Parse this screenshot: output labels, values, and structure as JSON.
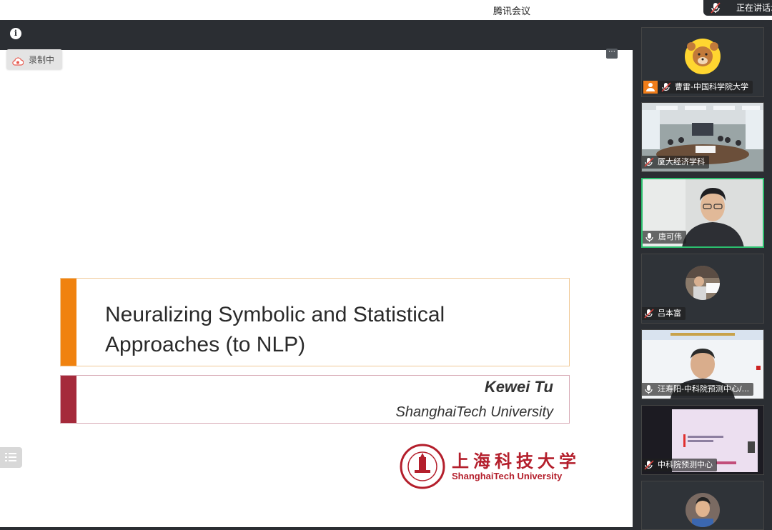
{
  "window": {
    "title": "腾讯会议"
  },
  "speaking_indicator": {
    "label": "正在讲话:"
  },
  "recording": {
    "label": "录制中"
  },
  "slide": {
    "title_line1": "Neuralizing Symbolic and Statistical",
    "title_line2": "Approaches (to NLP)",
    "author": "Kewei Tu",
    "affiliation": "ShanghaiTech University",
    "logo_cn": "上海科技大学",
    "logo_en": "ShanghaiTech University",
    "accent_orange": "#f0820f",
    "accent_red": "#a52a3b"
  },
  "participants": [
    {
      "name": "曹雷-中国科学院大学",
      "mic": "muted",
      "avatar": "bear-avatar",
      "host_badge": true
    },
    {
      "name": "厦大经济学科",
      "mic": "muted",
      "avatar": "video-conference-room"
    },
    {
      "name": "唐可伟",
      "mic": "on",
      "avatar": "video-man-glasses",
      "active": true
    },
    {
      "name": "吕本富",
      "mic": "muted",
      "avatar": "person-at-desk"
    },
    {
      "name": "汪寿阳-中科院预测中心/...",
      "mic": "on",
      "avatar": "video-man-presentation"
    },
    {
      "name": "中科院预测中心",
      "mic": "muted",
      "avatar": "video-projected-slide"
    },
    {
      "name": "",
      "mic": "",
      "avatar": "young-man-avatar"
    }
  ],
  "colors": {
    "toolbar": "#2b2e33",
    "active_border": "#2cbf6e"
  }
}
